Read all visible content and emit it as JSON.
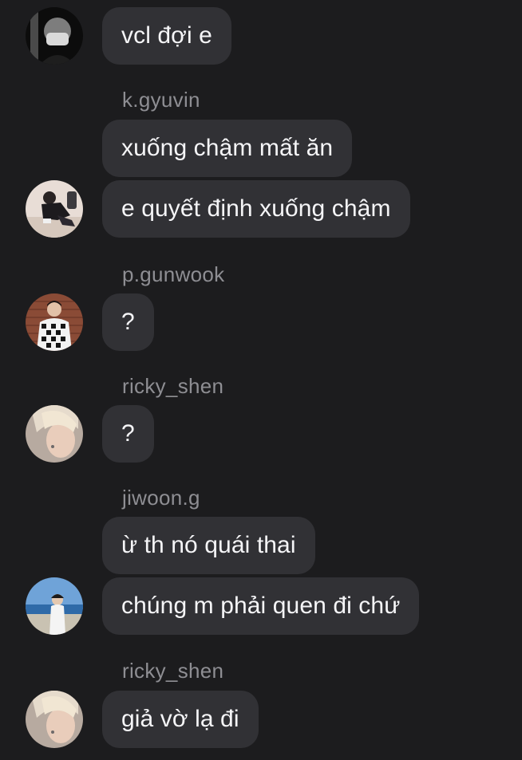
{
  "messages": [
    {
      "text": "vcl đợi e"
    },
    {
      "sender": "k.gyuvin",
      "text": "xuống chậm mất ăn"
    },
    {
      "text": "e quyết định xuống chậm"
    },
    {
      "sender": "p.gunwook",
      "text": "?"
    },
    {
      "sender": "ricky_shen",
      "text": "?"
    },
    {
      "sender": "jiwoon.g",
      "text": "ừ th nó quái thai"
    },
    {
      "text": "chúng m phải quen đi chứ"
    },
    {
      "sender": "ricky_shen",
      "text": "giả vờ lạ đi"
    }
  ]
}
